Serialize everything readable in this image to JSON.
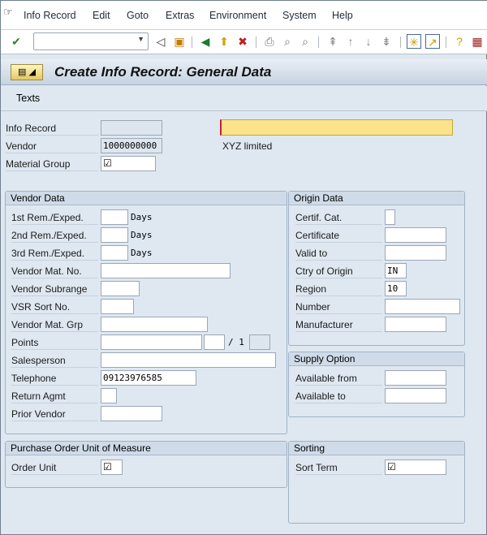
{
  "menu": {
    "items": [
      "Info Record",
      "Edit",
      "Goto",
      "Extras",
      "Environment",
      "System",
      "Help"
    ]
  },
  "toolbar": {
    "command_value": "",
    "icons": [
      "enter-icon",
      "back-arrow-icon",
      "save-icon",
      "back-icon",
      "exit-icon",
      "cancel-icon",
      "print-icon",
      "find-icon",
      "find-next-icon",
      "first-page-icon",
      "previous-page-icon",
      "next-page-icon",
      "last-page-icon",
      "create-session-icon",
      "shortcut-icon",
      "help-icon",
      "customize-layout-icon"
    ]
  },
  "header": {
    "title": "Create Info Record: General Data"
  },
  "appbar": {
    "texts_label": "Texts"
  },
  "top": {
    "info_record_label": "Info Record",
    "info_record_value": "",
    "vendor_label": "Vendor",
    "vendor_value": "1000000000",
    "material_group_label": "Material Group",
    "material_group_value": "☑",
    "material_value": "",
    "vendor_name": "XYZ limited"
  },
  "vendor_data": {
    "title": "Vendor Data",
    "days": "Days",
    "points_sep": "/ 1",
    "fields": [
      {
        "label": "1st Rem./Exped.",
        "value": ""
      },
      {
        "label": "2nd Rem./Exped.",
        "value": ""
      },
      {
        "label": "3rd Rem./Exped.",
        "value": ""
      },
      {
        "label": "Vendor Mat. No.",
        "value": ""
      },
      {
        "label": "Vendor Subrange",
        "value": ""
      },
      {
        "label": "VSR Sort No.",
        "value": ""
      },
      {
        "label": "Vendor Mat. Grp",
        "value": ""
      },
      {
        "label": "Points",
        "value": ""
      },
      {
        "label": "Salesperson",
        "value": ""
      },
      {
        "label": "Telephone",
        "value": "09123976585"
      },
      {
        "label": "Return Agmt",
        "value": ""
      },
      {
        "label": "Prior Vendor",
        "value": ""
      }
    ]
  },
  "origin_data": {
    "title": "Origin Data",
    "fields": [
      {
        "label": "Certif. Cat.",
        "value": ""
      },
      {
        "label": "Certificate",
        "value": ""
      },
      {
        "label": "Valid to",
        "value": ""
      },
      {
        "label": "Ctry of Origin",
        "value": "IN"
      },
      {
        "label": "Region",
        "value": "10"
      },
      {
        "label": "Number",
        "value": ""
      },
      {
        "label": "Manufacturer",
        "value": ""
      }
    ]
  },
  "supply_option": {
    "title": "Supply Option",
    "fields": [
      {
        "label": "Available from",
        "value": ""
      },
      {
        "label": "Available to",
        "value": ""
      }
    ]
  },
  "po_unit": {
    "title": "Purchase Order Unit of Measure",
    "order_unit_label": "Order Unit",
    "order_unit_value": "☑"
  },
  "sorting": {
    "title": "Sorting",
    "sort_term_label": "Sort Term",
    "sort_term_value": "☑"
  }
}
